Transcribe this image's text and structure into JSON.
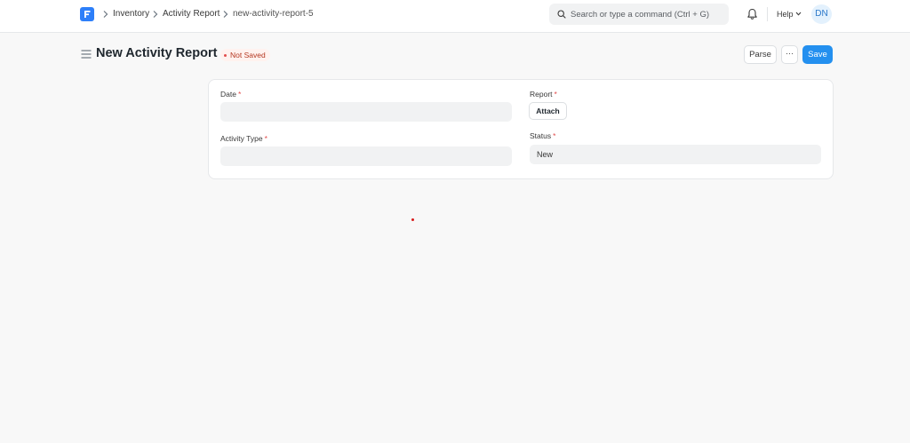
{
  "navbar": {
    "breadcrumbs": [
      "Inventory",
      "Activity Report",
      "new-activity-report-5"
    ],
    "search_placeholder": "Search or type a command (Ctrl + G)",
    "help_label": "Help",
    "avatar_initials": "DN"
  },
  "page": {
    "title": "New Activity Report",
    "status_indicator": "Not Saved",
    "buttons": {
      "parse": "Parse",
      "more": "···",
      "save": "Save"
    }
  },
  "form": {
    "date": {
      "label": "Date",
      "required": "*",
      "value": ""
    },
    "activity_type": {
      "label": "Activity Type",
      "required": "*",
      "value": ""
    },
    "report": {
      "label": "Report",
      "required": "*",
      "attach_label": "Attach"
    },
    "status": {
      "label": "Status",
      "required": "*",
      "value": "New"
    }
  },
  "colors": {
    "primary": "#2490ef",
    "logo": "#2d7ff9",
    "required_mark": "#e24c4c",
    "not_saved_text": "#b43721"
  },
  "icons": {
    "logo": "frappe-logo-icon",
    "breadcrumb_separator": "chevron-right-icon",
    "search": "search-icon",
    "notifications": "bell-icon",
    "help_dropdown": "chevron-down-icon",
    "sidebar_toggle": "menu-icon"
  }
}
